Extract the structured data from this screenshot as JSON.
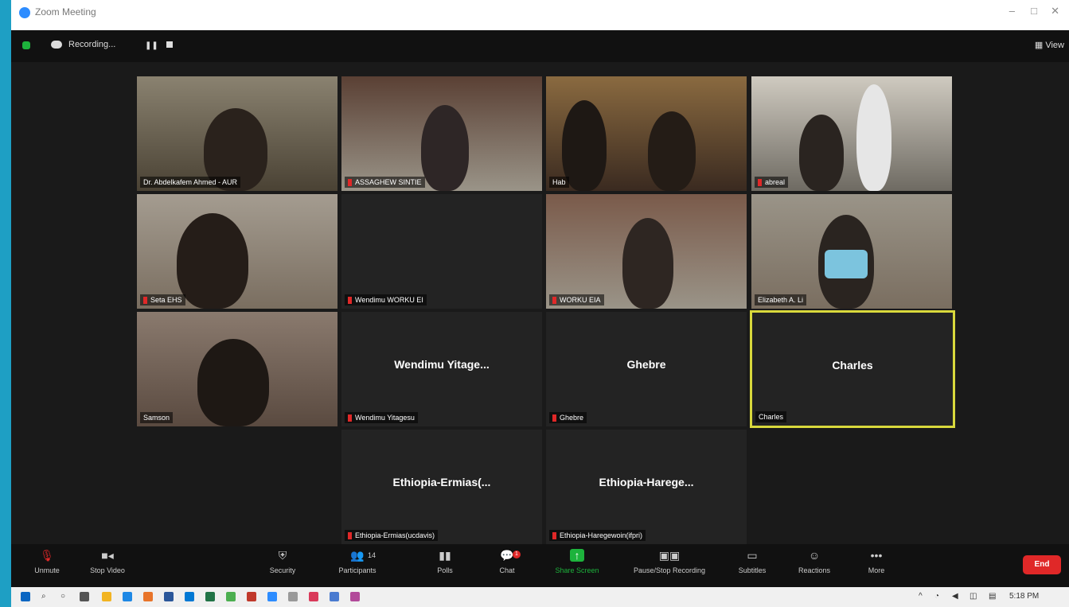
{
  "window": {
    "title": "Zoom Meeting"
  },
  "top_bar": {
    "recording_label": "Recording...",
    "view_label": "View"
  },
  "tiles": [
    {
      "name": "Dr. Abdelkafem Ahmed - AUR",
      "type": "video",
      "active": false
    },
    {
      "name": "ASSAGHEW SINTIE",
      "type": "video",
      "active": false
    },
    {
      "name": "Hab",
      "type": "video",
      "active": false
    },
    {
      "name": "abreal",
      "type": "video",
      "active": false
    },
    {
      "name": "Seta EHS",
      "type": "video",
      "active": false
    },
    {
      "name": "Wendimu WORKU EI",
      "type": "blank",
      "active": false
    },
    {
      "name": "WORKU EIA",
      "type": "video",
      "active": false
    },
    {
      "name": "Elizabeth A. Li",
      "type": "video",
      "active": false
    },
    {
      "name": "Samson",
      "type": "video",
      "active": false
    },
    {
      "name": "Wendimu Yitagesu",
      "display": "Wendimu  Yitage...",
      "type": "name",
      "active": false
    },
    {
      "name": "Ghebre",
      "display": "Ghebre",
      "type": "name",
      "active": false
    },
    {
      "name": "Charles",
      "display": "Charles",
      "type": "name",
      "active": true
    },
    {
      "name": "Ethiopia-Ermias(ucdavis)",
      "display": "Ethiopia-Ermias(...",
      "type": "name",
      "active": false
    },
    {
      "name": "Ethiopia-Haregewoin(ifpri)",
      "display": "Ethiopia-Harege...",
      "type": "name",
      "active": false
    }
  ],
  "toolbar": {
    "unmute": "Unmute",
    "stop_video": "Stop Video",
    "security": "Security",
    "participants": "Participants",
    "participants_count": "14",
    "polls": "Polls",
    "chat": "Chat",
    "chat_badge": "1",
    "share_screen": "Share Screen",
    "pause_recording": "Pause/Stop Recording",
    "subtitles": "Subtitles",
    "reactions": "Reactions",
    "more": "More",
    "end": "End"
  },
  "taskbar": {
    "time": "5:18 PM"
  },
  "colors": {
    "accent_green": "#1db33c",
    "end_red": "#e02828",
    "active_speaker": "#d9d93c"
  }
}
